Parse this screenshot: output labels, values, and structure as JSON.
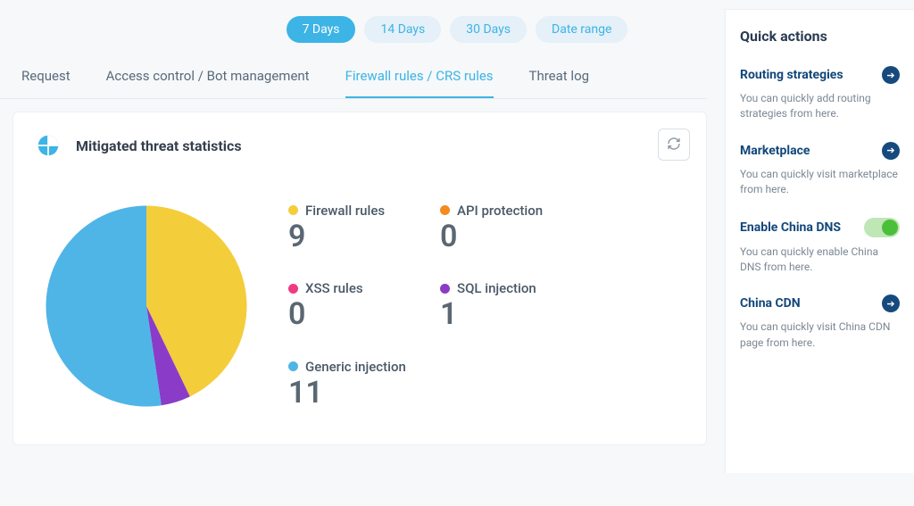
{
  "date_ranges": [
    "7 Days",
    "14 Days",
    "30 Days",
    "Date range"
  ],
  "date_active_index": 0,
  "tabs": [
    "Request",
    "Access control / Bot management",
    "Firewall rules / CRS rules",
    "Threat log"
  ],
  "tab_active_index": 2,
  "card": {
    "title": "Mitigated threat statistics"
  },
  "chart_data": {
    "type": "pie",
    "categories": [
      "Firewall rules",
      "API protection",
      "XSS rules",
      "SQL injection",
      "Generic injection"
    ],
    "values": [
      9,
      0,
      0,
      1,
      11
    ],
    "colors": [
      "#f4cd3b",
      "#f58a1f",
      "#ee3c83",
      "#8a3cc8",
      "#4fb5e6"
    ]
  },
  "stats": [
    {
      "label": "Firewall rules",
      "value": "9",
      "color": "#f4cd3b"
    },
    {
      "label": "API protection",
      "value": "0",
      "color": "#f58a1f"
    },
    {
      "label": "XSS rules",
      "value": "0",
      "color": "#ee3c83"
    },
    {
      "label": "SQL injection",
      "value": "1",
      "color": "#8a3cc8"
    },
    {
      "label": "Generic injection",
      "value": "11",
      "color": "#4fb5e6"
    }
  ],
  "sidebar": {
    "title": "Quick actions",
    "items": [
      {
        "label": "Routing strategies",
        "desc": "You can quickly add routing strategies from here.",
        "control": "arrow"
      },
      {
        "label": "Marketplace",
        "desc": "You can quickly visit marketplace from here.",
        "control": "arrow"
      },
      {
        "label": "Enable China DNS",
        "desc": "You can quickly enable China DNS from here.",
        "control": "toggle"
      },
      {
        "label": "China CDN",
        "desc": "You can quickly visit China CDN page from here.",
        "control": "arrow"
      }
    ]
  }
}
